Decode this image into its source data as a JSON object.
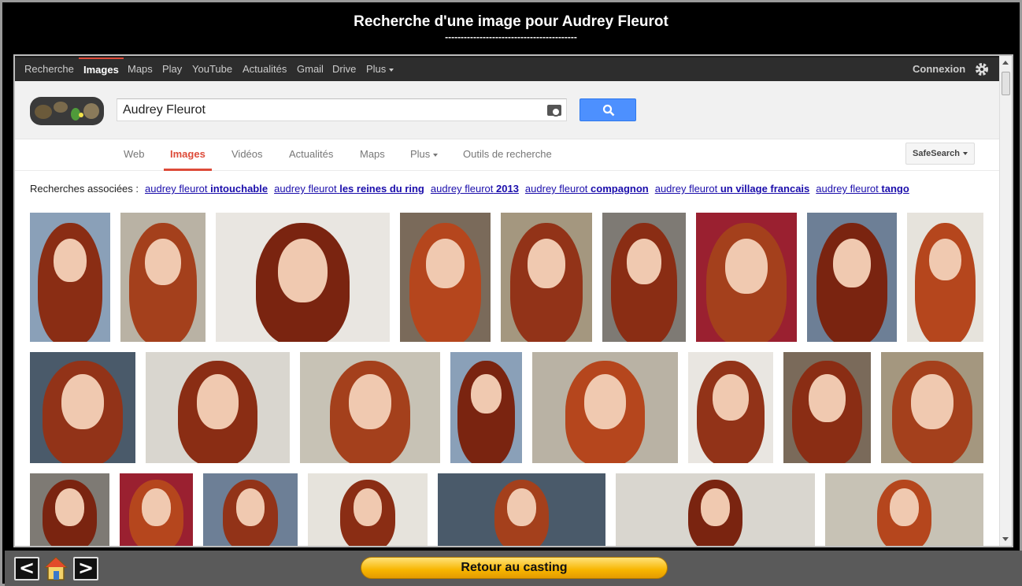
{
  "header": {
    "title": "Recherche d'une image pour Audrey Fleurot",
    "rule": "------------------------------------------"
  },
  "gbar": {
    "items": [
      "Recherche",
      "Images",
      "Maps",
      "Play",
      "YouTube",
      "Actualités",
      "Gmail",
      "Drive",
      "Plus"
    ],
    "active_index": 1,
    "signin": "Connexion",
    "settings_icon": "gear-icon"
  },
  "search": {
    "query": "Audrey Fleurot",
    "camera_icon": "camera-icon",
    "button_icon": "search-icon"
  },
  "tabs": {
    "items": [
      "Web",
      "Images",
      "Vidéos",
      "Actualités",
      "Maps",
      "Plus",
      "Outils de recherche"
    ],
    "active_index": 1,
    "safesearch": "SafeSearch"
  },
  "related": {
    "label": "Recherches associées :",
    "links": [
      {
        "base": "audrey fleurot",
        "bold": "intouchable"
      },
      {
        "base": "audrey fleurot",
        "bold": "les reines du ring"
      },
      {
        "base": "audrey fleurot",
        "bold": "2013"
      },
      {
        "base": "audrey fleurot",
        "bold": "compagnon"
      },
      {
        "base": "audrey fleurot",
        "bold": "un village francais"
      },
      {
        "base": "audrey fleurot",
        "bold": "tango"
      }
    ]
  },
  "footer": {
    "back_label": "<",
    "forward_label": ">",
    "home_icon": "home-icon",
    "retour_label": "Retour au casting"
  },
  "colors": {
    "accent_red": "#dd4b39",
    "search_blue": "#4d90fe",
    "link_blue": "#1a0dab",
    "gold_button": "#f7b500"
  }
}
